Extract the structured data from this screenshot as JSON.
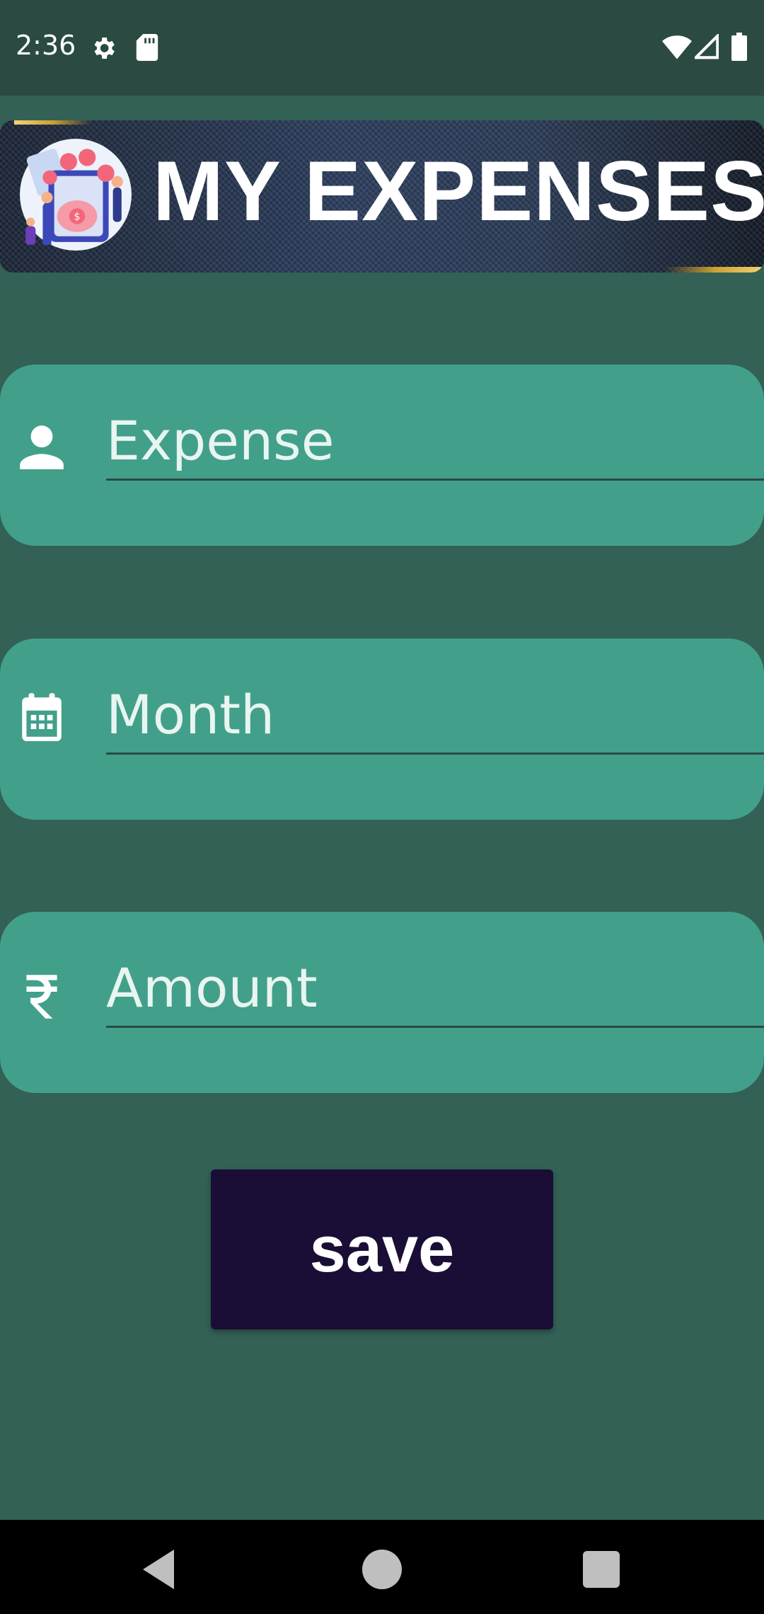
{
  "status_bar": {
    "time": "2:36",
    "icons": [
      "settings-icon",
      "sd-card-icon",
      "wifi-icon",
      "signal-icon",
      "battery-icon"
    ]
  },
  "header": {
    "title": "MY EXPENSES",
    "logo_icon": "expenses-illustration-icon"
  },
  "form": {
    "expense": {
      "placeholder": "Expense",
      "value": "",
      "icon": "person-icon"
    },
    "month": {
      "placeholder": "Month",
      "value": "",
      "icon": "calendar-icon"
    },
    "amount": {
      "placeholder": "Amount",
      "value": "",
      "icon": "rupee-icon"
    },
    "save_label": "save"
  },
  "nav_bar": {
    "icons": [
      "back-icon",
      "home-icon",
      "recents-icon"
    ]
  },
  "colors": {
    "background": "#336155",
    "status_bar": "#2a4a42",
    "field_card": "#42a08a",
    "save_button": "#1a0e36"
  }
}
